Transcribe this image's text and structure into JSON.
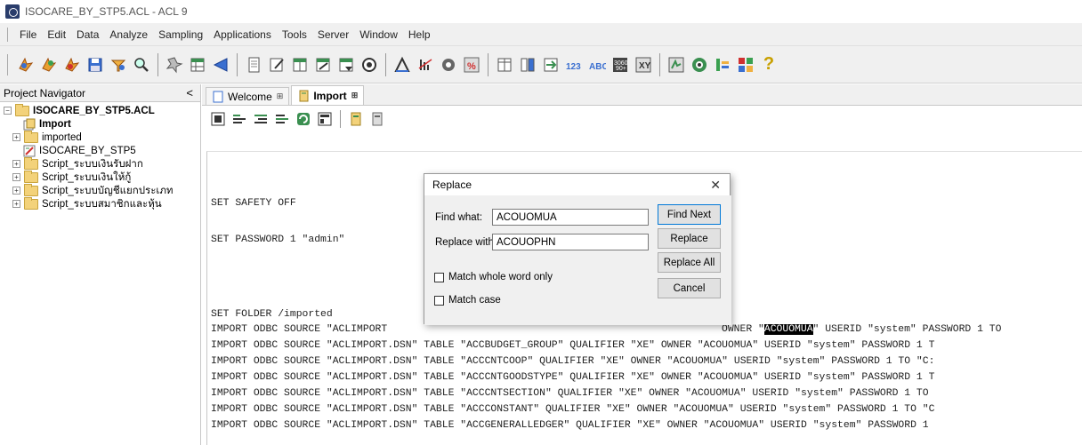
{
  "window": {
    "title": "ISOCARE_BY_STP5.ACL - ACL 9"
  },
  "menu": [
    "File",
    "Edit",
    "Data",
    "Analyze",
    "Sampling",
    "Applications",
    "Tools",
    "Server",
    "Window",
    "Help"
  ],
  "toolbar": {
    "groups": [
      [
        "open-project-icon",
        "new-project-icon",
        "open-table-icon",
        "save-icon",
        "filter-icon",
        "search-icon"
      ],
      [
        "history-icon",
        "table-layout-icon",
        "notes-icon"
      ],
      [
        "document-icon",
        "edit-icon",
        "view-icon",
        "modify-icon",
        "index-icon",
        "expression-icon"
      ],
      [
        "statistics-icon",
        "benford-icon",
        "stratify-icon",
        "percent-icon"
      ],
      [
        "summarize-icon",
        "classify-icon",
        "join-icon",
        "sequence-icon",
        "duplicates-icon",
        "sample-icon",
        "gaps-icon"
      ],
      [
        "script-icon",
        "refresh-icon",
        "report-icon",
        "grid-icon",
        "help-icon"
      ]
    ],
    "help_glyph": "?"
  },
  "navigator": {
    "title": "Project Navigator",
    "collapse_glyph": "<",
    "tree": [
      {
        "label": "ISOCARE_BY_STP5.ACL",
        "level": 0,
        "expander": "−",
        "type": "folder",
        "bold": true
      },
      {
        "label": "Import",
        "level": 1,
        "type": "table",
        "bold": true
      },
      {
        "label": "imported",
        "level": 1,
        "expander": "+",
        "type": "folder"
      },
      {
        "label": "ISOCARE_BY_STP5",
        "level": 1,
        "type": "log"
      },
      {
        "label": "Script_ระบบเงินรับฝาก",
        "level": 1,
        "expander": "+",
        "type": "folder"
      },
      {
        "label": "Script_ระบบเงินให้กู้",
        "level": 1,
        "expander": "+",
        "type": "folder"
      },
      {
        "label": "Script_ระบบบัญชีแยกประเภท",
        "level": 1,
        "expander": "+",
        "type": "folder"
      },
      {
        "label": "Script_ระบบสมาชิกและหุ้น",
        "level": 1,
        "expander": "+",
        "type": "folder"
      }
    ]
  },
  "tabs": [
    {
      "label": "Welcome",
      "active": false
    },
    {
      "label": "Import",
      "active": true
    }
  ],
  "script_toolbar": [
    "run-icon",
    "step-icon",
    "run-selected-icon",
    "indent-icon",
    "refresh-script-icon",
    "grid-icon",
    "script-yellow-icon",
    "script-gray-icon"
  ],
  "editor": {
    "lines": [
      {
        "text": "SET SAFETY OFF",
        "row": 0
      },
      {
        "text": "SET PASSWORD 1 \"admin\"",
        "row": 1
      },
      {
        "text": "SET FOLDER /imported",
        "row": 2
      },
      {
        "text": "IMPORT ODBC SOURCE \"ACLIMPORT",
        "tail_before": "OWNER \"",
        "hl": "ACOUOMUA",
        "tail_after": "\" USERID \"system\" PASSWORD 1 TO",
        "row": 3
      },
      {
        "text": "IMPORT ODBC SOURCE \"ACLIMPORT.DSN\" TABLE \"ACCBUDGET_GROUP\" QUALIFIER \"XE\" OWNER \"ACOUOMUA\" USERID \"system\" PASSWORD 1 T",
        "row": 4
      },
      {
        "text": "IMPORT ODBC SOURCE \"ACLIMPORT.DSN\" TABLE \"ACCCNTCOOP\" QUALIFIER \"XE\" OWNER \"ACOUOMUA\" USERID \"system\" PASSWORD 1 TO \"C:",
        "row": 5
      },
      {
        "text": "IMPORT ODBC SOURCE \"ACLIMPORT.DSN\" TABLE \"ACCCNTGOODSTYPE\" QUALIFIER \"XE\" OWNER \"ACOUOMUA\" USERID \"system\" PASSWORD 1 T",
        "row": 6
      },
      {
        "text": "IMPORT ODBC SOURCE \"ACLIMPORT.DSN\" TABLE \"ACCCNTSECTION\" QUALIFIER \"XE\" OWNER \"ACOUOMUA\" USERID \"system\" PASSWORD 1 TO",
        "row": 7
      },
      {
        "text": "IMPORT ODBC SOURCE \"ACLIMPORT.DSN\" TABLE \"ACCCONSTANT\" QUALIFIER \"XE\" OWNER \"ACOUOMUA\" USERID \"system\" PASSWORD 1 TO \"C",
        "row": 8
      },
      {
        "text": "IMPORT ODBC SOURCE \"ACLIMPORT.DSN\" TABLE \"ACCGENERALLEDGER\" QUALIFIER \"XE\" OWNER \"ACOUOMUA\" USERID \"system\" PASSWORD 1",
        "row": 9
      }
    ]
  },
  "dialog": {
    "title": "Replace",
    "close_glyph": "✕",
    "find_label": "Find what:",
    "find_value": "ACOUOMUA",
    "replace_label": "Replace with:",
    "replace_value": "ACOUOPHN",
    "match_whole_word": "Match whole word only",
    "match_case": "Match case",
    "btn_find_next": "Find Next",
    "btn_replace": "Replace",
    "btn_replace_all": "Replace All",
    "btn_cancel": "Cancel"
  }
}
